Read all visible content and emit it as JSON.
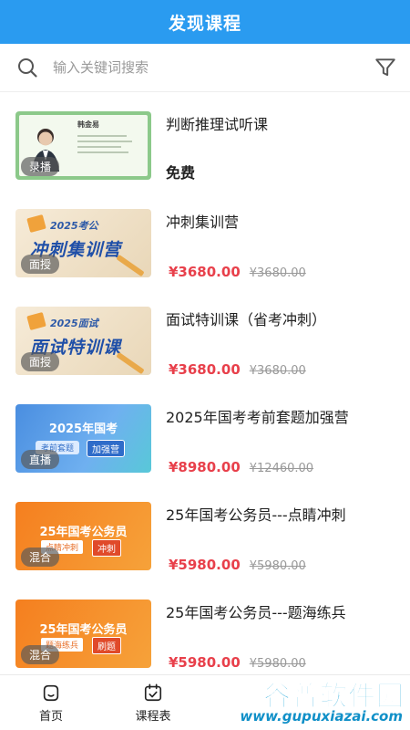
{
  "header": {
    "title": "发现课程"
  },
  "search": {
    "placeholder": "输入关键词搜索",
    "value": ""
  },
  "courses": [
    {
      "title": "判断推理试听课",
      "badge": "录播",
      "free_label": "免费",
      "thumb": {
        "teacher": "韩金易"
      }
    },
    {
      "title": "冲刺集训营",
      "badge": "面授",
      "price": "¥3680.00",
      "original_price": "¥3680.00",
      "thumb": {
        "year_text": "2025考公",
        "big_text": "冲刺集训营"
      }
    },
    {
      "title": "面试特训课（省考冲刺）",
      "badge": "面授",
      "price": "¥3680.00",
      "original_price": "¥3680.00",
      "thumb": {
        "year_text": "2025面试",
        "big_text": "面试特训课"
      }
    },
    {
      "title": "2025年国考考前套题加强营",
      "badge": "直播",
      "price": "¥8980.00",
      "original_price": "¥12460.00",
      "thumb": {
        "main_text": "2025年国考",
        "tag_a": "考前套题",
        "tag_b": "加强营"
      }
    },
    {
      "title": "25年国考公务员---点睛冲刺",
      "badge": "混合",
      "price": "¥5980.00",
      "original_price": "¥5980.00",
      "thumb": {
        "main_text": "25年国考公务员",
        "tag_a": "点睛冲刺",
        "tag_b": "冲刺"
      }
    },
    {
      "title": "25年国考公务员---题海练兵",
      "badge": "混合",
      "price": "¥5980.00",
      "original_price": "¥5980.00",
      "thumb": {
        "main_text": "25年国考公务员",
        "tag_a": "题海练兵",
        "tag_b": "刷题"
      }
    }
  ],
  "tabs": [
    {
      "label": "首页",
      "icon": "home-icon"
    },
    {
      "label": "课程表",
      "icon": "calendar-icon"
    }
  ],
  "watermark": {
    "title": "谷普软件园",
    "url": "www.gupuxiazai.com"
  },
  "colors": {
    "header_bg": "#2A9BF0",
    "price": "#E8404B",
    "watermark": "#16A3D8"
  }
}
